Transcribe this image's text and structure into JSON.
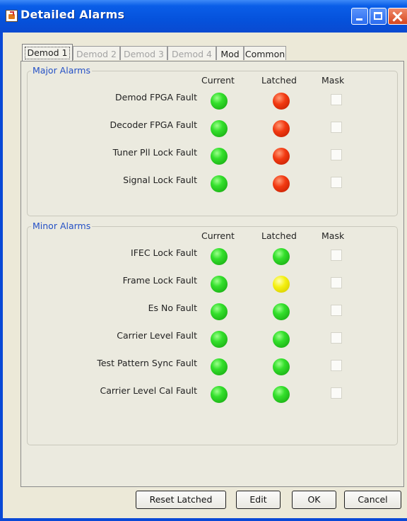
{
  "window": {
    "title": "Detailed Alarms"
  },
  "tabs": [
    {
      "label": "Demod 1",
      "state": "selected"
    },
    {
      "label": "Demod 2",
      "state": "disabled"
    },
    {
      "label": "Demod 3",
      "state": "disabled"
    },
    {
      "label": "Demod 4",
      "state": "disabled"
    },
    {
      "label": "Mod",
      "state": "enabled"
    },
    {
      "label": "Common",
      "state": "enabled"
    }
  ],
  "major": {
    "title": "Major Alarms",
    "headers": {
      "current": "Current",
      "latched": "Latched",
      "mask": "Mask"
    },
    "rows": [
      {
        "label": "Demod FPGA Fault",
        "current": "green",
        "latched": "red",
        "mask": false
      },
      {
        "label": "Decoder FPGA Fault",
        "current": "green",
        "latched": "red",
        "mask": false
      },
      {
        "label": "Tuner Pll Lock Fault",
        "current": "green",
        "latched": "red",
        "mask": false
      },
      {
        "label": "Signal Lock Fault",
        "current": "green",
        "latched": "red",
        "mask": false
      }
    ]
  },
  "minor": {
    "title": "Minor Alarms",
    "headers": {
      "current": "Current",
      "latched": "Latched",
      "mask": "Mask"
    },
    "rows": [
      {
        "label": "IFEC Lock Fault",
        "current": "green",
        "latched": "green",
        "mask": false
      },
      {
        "label": "Frame Lock Fault",
        "current": "green",
        "latched": "yellow",
        "mask": false
      },
      {
        "label": "Es No Fault",
        "current": "green",
        "latched": "green",
        "mask": false
      },
      {
        "label": "Carrier Level Fault",
        "current": "green",
        "latched": "green",
        "mask": false
      },
      {
        "label": "Test Pattern Sync Fault",
        "current": "green",
        "latched": "green",
        "mask": false
      },
      {
        "label": "Carrier Level Cal Fault",
        "current": "green",
        "latched": "green",
        "mask": false
      }
    ]
  },
  "buttons": {
    "reset_latched": "Reset Latched",
    "edit": "Edit",
    "ok": "OK",
    "cancel": "Cancel"
  },
  "colors": {
    "green": "#22c41a",
    "red": "#e0300a",
    "yellow": "#eee30a",
    "group_title": "#2450c6",
    "titlebar": "#0552dc"
  }
}
